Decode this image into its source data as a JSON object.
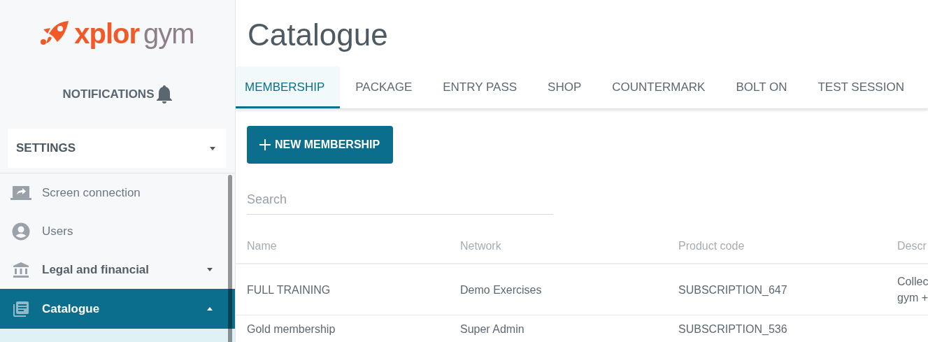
{
  "logo": {
    "brand": "xplor",
    "product": "gym"
  },
  "notifications": {
    "label": "NOTIFICATIONS"
  },
  "settings": {
    "label": "SETTINGS",
    "expanded": false
  },
  "sidebar": {
    "items": [
      {
        "label": "Screen connection",
        "kind": "link",
        "selected": false
      },
      {
        "label": "Users",
        "kind": "link",
        "selected": false
      },
      {
        "label": "Legal and financial",
        "kind": "group",
        "expanded": false,
        "selected": false
      },
      {
        "label": "Catalogue",
        "kind": "group",
        "expanded": true,
        "selected": true
      }
    ]
  },
  "page": {
    "title": "Catalogue"
  },
  "tabs": [
    {
      "label": "MEMBERSHIP",
      "selected": true
    },
    {
      "label": "PACKAGE",
      "selected": false
    },
    {
      "label": "ENTRY PASS",
      "selected": false
    },
    {
      "label": "SHOP",
      "selected": false
    },
    {
      "label": "COUNTERMARK",
      "selected": false
    },
    {
      "label": "BOLT ON",
      "selected": false
    },
    {
      "label": "TEST SESSION",
      "selected": false
    }
  ],
  "new_button": {
    "label": "NEW MEMBERSHIP"
  },
  "search": {
    "placeholder": "Search"
  },
  "table": {
    "columns": [
      "Name",
      "Network",
      "Product code",
      "Descr"
    ],
    "rows": [
      [
        "FULL TRAINING",
        "Demo Exercises",
        "SUBSCRIPTION_647",
        "Collec\ngym +"
      ],
      [
        "Gold membership",
        "Super Admin",
        "SUBSCRIPTION_536"
      ]
    ]
  }
}
